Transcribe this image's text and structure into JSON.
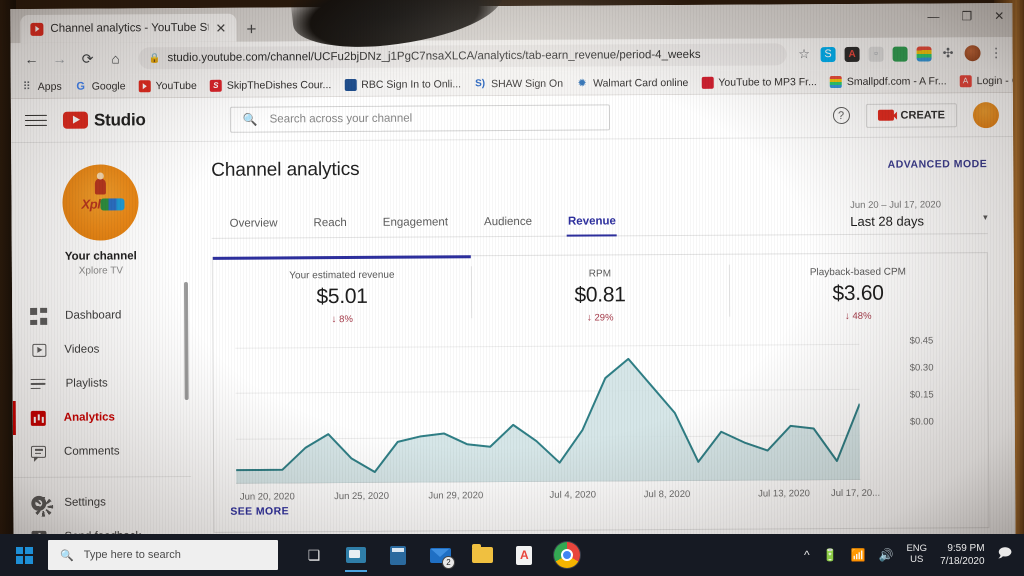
{
  "browser": {
    "tab": {
      "title": "Channel analytics - YouTube Stu",
      "close_label": "✕",
      "favicon": "youtube-icon"
    },
    "new_tab_label": "+",
    "window_controls": {
      "minimize": "—",
      "maximize": "❐",
      "close": "✕"
    },
    "nav": {
      "back": "←",
      "forward": "→",
      "reload": "⟳",
      "home": "⌂"
    },
    "address": {
      "lock_icon": "lock-icon",
      "url": "studio.youtube.com/channel/UCFu2bjDNz_j1PgC7nsaXLCA/analytics/tab-earn_revenue/period-4_weeks"
    },
    "omnibox_icons": [
      {
        "name": "bookmark-star-icon",
        "glyph": "☆"
      },
      {
        "name": "skype-extension-icon",
        "glyph": "S"
      },
      {
        "name": "acrobat-extension-icon",
        "glyph": "A"
      },
      {
        "name": "inactive-extension-icon",
        "glyph": "▫"
      },
      {
        "name": "globe-extension-icon",
        "glyph": "◉"
      },
      {
        "name": "smallpdf-extension-icon",
        "glyph": ""
      },
      {
        "name": "extensions-puzzle-icon",
        "glyph": "✣"
      },
      {
        "name": "profile-avatar-icon",
        "glyph": ""
      },
      {
        "name": "chrome-menu-icon",
        "glyph": "⋮"
      }
    ],
    "bookmarks": [
      {
        "label": "Apps",
        "icon": "apps-grid-icon",
        "glyph": "⠿"
      },
      {
        "label": "Google",
        "icon": "google-icon",
        "glyph": "G"
      },
      {
        "label": "YouTube",
        "icon": "youtube-icon",
        "glyph": ""
      },
      {
        "label": "SkipTheDishes Cour...",
        "icon": "skipthedishes-icon",
        "glyph": "S"
      },
      {
        "label": "RBC Sign In to Onli...",
        "icon": "rbc-icon",
        "glyph": ""
      },
      {
        "label": "SHAW Sign On",
        "icon": "shaw-icon",
        "glyph": "S)"
      },
      {
        "label": "Walmart Card online",
        "icon": "walmart-icon",
        "glyph": "✹"
      },
      {
        "label": "YouTube to MP3 Fr...",
        "icon": "mp3-icon",
        "glyph": "MP3"
      },
      {
        "label": "Smallpdf.com - A Fr...",
        "icon": "smallpdf-icon",
        "glyph": ""
      },
      {
        "label": "Login - Gsnnfast Unl...",
        "icon": "login-icon",
        "glyph": "A"
      }
    ],
    "bookmarks_overflow": "»"
  },
  "studio": {
    "header": {
      "menu_icon": "hamburger-menu-icon",
      "logo_text": "Studio",
      "search_placeholder": "Search across your channel",
      "search_icon": "search-icon",
      "help_icon": "help-question-icon",
      "create_label": "CREATE",
      "create_icon": "video-camera-icon",
      "avatar": "channel-avatar"
    },
    "sidebar": {
      "channel_label": "Your channel",
      "channel_name": "Xplore TV",
      "avatar_word": "Xplore",
      "items": [
        {
          "label": "Dashboard",
          "icon": "dashboard-icon",
          "active": false
        },
        {
          "label": "Videos",
          "icon": "videos-icon",
          "active": false
        },
        {
          "label": "Playlists",
          "icon": "playlists-icon",
          "active": false
        },
        {
          "label": "Analytics",
          "icon": "analytics-bar-icon",
          "active": true
        },
        {
          "label": "Comments",
          "icon": "comments-icon",
          "active": false
        },
        {
          "label": "Settings",
          "icon": "gear-icon",
          "active": false
        },
        {
          "label": "Send feedback",
          "icon": "feedback-icon",
          "active": false
        }
      ]
    },
    "main": {
      "title": "Channel analytics",
      "advanced_mode": "ADVANCED MODE",
      "tabs": [
        {
          "label": "Overview",
          "active": false
        },
        {
          "label": "Reach",
          "active": false
        },
        {
          "label": "Engagement",
          "active": false
        },
        {
          "label": "Audience",
          "active": false
        },
        {
          "label": "Revenue",
          "active": true
        }
      ],
      "date_range": {
        "range_text": "Jun 20 – Jul 17, 2020",
        "preset": "Last 28 days",
        "caret": "▾"
      },
      "metrics": [
        {
          "label": "Your estimated revenue",
          "value": "$5.01",
          "delta": "8%",
          "arrow": "↓",
          "selected": true
        },
        {
          "label": "RPM",
          "value": "$0.81",
          "delta": "29%",
          "arrow": "↓",
          "selected": false
        },
        {
          "label": "Playback-based CPM",
          "value": "$3.60",
          "delta": "48%",
          "arrow": "↓",
          "selected": false
        }
      ],
      "see_more": "SEE MORE",
      "accent_color": "#2d2f9e",
      "line_color": "#2f7f86",
      "fill_color": "#cfe2e4"
    }
  },
  "chart_data": {
    "type": "area",
    "title": "Your estimated revenue",
    "xlabel": "",
    "ylabel": "",
    "ylim": [
      0,
      0.5
    ],
    "grid": true,
    "legend": "none",
    "yticks": [
      "$0.00",
      "$0.15",
      "$0.30",
      "$0.45"
    ],
    "ytick_values": [
      0.0,
      0.15,
      0.3,
      0.45
    ],
    "xtick_labels": [
      "Jun 20, 2020",
      "Jun 25, 2020",
      "Jun 29, 2020",
      "Jul 4, 2020",
      "Jul 8, 2020",
      "Jul 13, 2020",
      "Jul 17, 20..."
    ],
    "xtick_indices": [
      0,
      5,
      9,
      14,
      18,
      23,
      27
    ],
    "x": [
      "Jun 20, 2020",
      "Jun 21, 2020",
      "Jun 22, 2020",
      "Jun 23, 2020",
      "Jun 24, 2020",
      "Jun 25, 2020",
      "Jun 26, 2020",
      "Jun 27, 2020",
      "Jun 28, 2020",
      "Jun 29, 2020",
      "Jun 30, 2020",
      "Jul 1, 2020",
      "Jul 2, 2020",
      "Jul 3, 2020",
      "Jul 4, 2020",
      "Jul 5, 2020",
      "Jul 6, 2020",
      "Jul 7, 2020",
      "Jul 8, 2020",
      "Jul 9, 2020",
      "Jul 10, 2020",
      "Jul 11, 2020",
      "Jul 12, 2020",
      "Jul 13, 2020",
      "Jul 14, 2020",
      "Jul 15, 2020",
      "Jul 16, 2020",
      "Jul 17, 2020"
    ],
    "values": [
      0.05,
      0.05,
      0.05,
      0.13,
      0.18,
      0.09,
      0.04,
      0.15,
      0.17,
      0.18,
      0.14,
      0.13,
      0.21,
      0.15,
      0.07,
      0.19,
      0.38,
      0.45,
      0.35,
      0.25,
      0.07,
      0.18,
      0.14,
      0.11,
      0.2,
      0.19,
      0.07,
      0.28
    ],
    "series": [
      {
        "name": "Your estimated revenue",
        "color": "#2f7f86"
      }
    ]
  },
  "taskbar": {
    "start_icon": "windows-start-icon",
    "search_placeholder": "Type here to search",
    "search_icon": "search-icon",
    "items": [
      {
        "name": "task-view-icon",
        "glyph": "❏"
      },
      {
        "name": "app-teams-icon",
        "glyph": ""
      },
      {
        "name": "app-calculator-icon",
        "glyph": ""
      },
      {
        "name": "app-mail-icon",
        "glyph": "",
        "badge": "2"
      },
      {
        "name": "app-file-explorer-icon",
        "glyph": ""
      },
      {
        "name": "app-acrobat-reader-icon",
        "glyph": ""
      },
      {
        "name": "app-google-chrome-icon",
        "glyph": ""
      }
    ],
    "tray": {
      "show_hidden": "^",
      "battery_icon": "battery-icon",
      "network_icon": "wifi-icon",
      "volume_icon": "volume-icon",
      "language": "ENG",
      "region": "US",
      "time": "9:59 PM",
      "date": "7/18/2020",
      "notification_icon": "notification-icon"
    }
  }
}
